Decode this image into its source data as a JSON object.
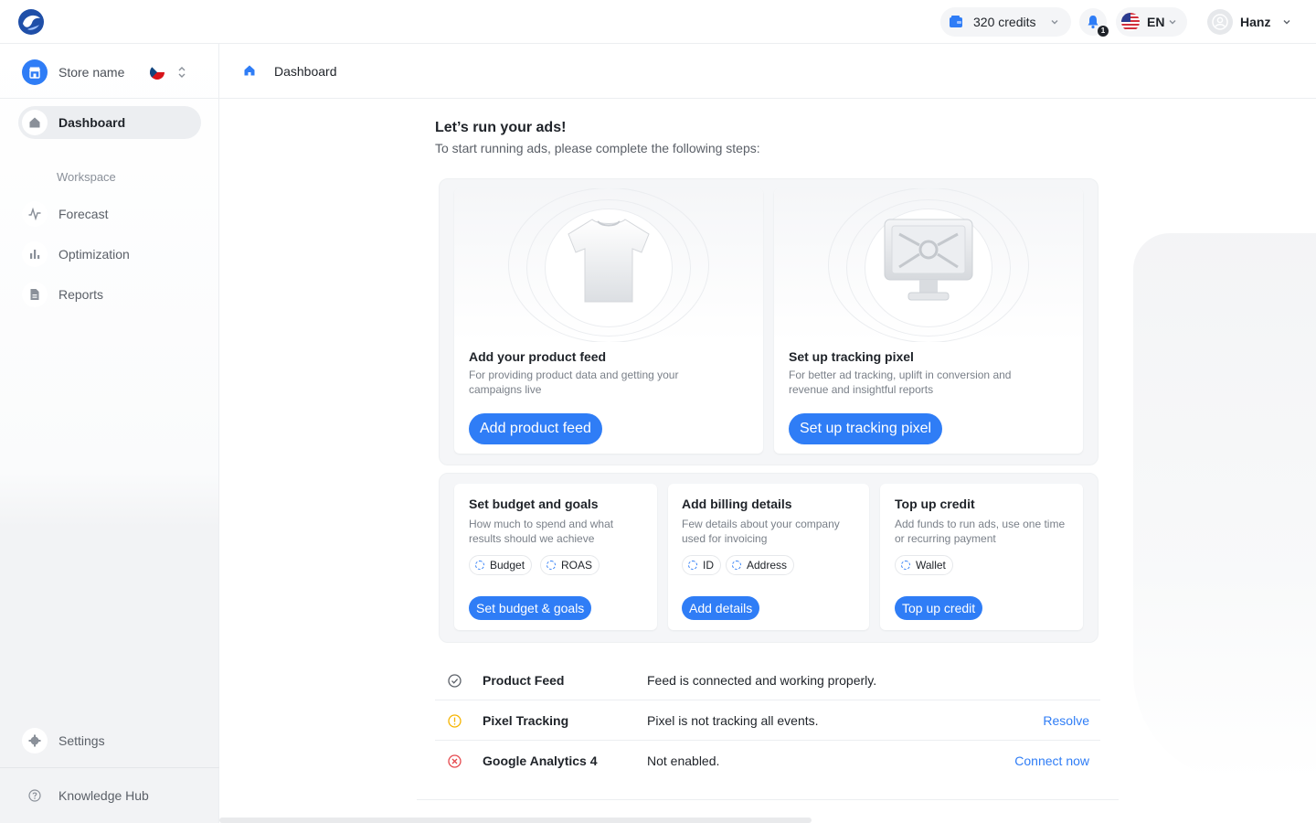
{
  "topbar": {
    "credits_label": "320 credits",
    "notifications_count": "1",
    "language": "EN",
    "user_name": "Hanz"
  },
  "sidebar": {
    "store_name": "Store name",
    "items": [
      {
        "label": "Dashboard",
        "icon": "home-icon",
        "active": true
      },
      {
        "label": "Forecast",
        "icon": "pulse-icon"
      },
      {
        "label": "Optimization",
        "icon": "bar-chart-icon"
      },
      {
        "label": "Reports",
        "icon": "document-icon"
      }
    ],
    "workspace_label": "Workspace",
    "settings_label": "Settings",
    "knowledge_label": "Knowledge Hub"
  },
  "breadcrumb": {
    "current": "Dashboard"
  },
  "main": {
    "title": "Let’s run your ads!",
    "subtitle": "To start running ads, please complete the following steps:",
    "big_cards": [
      {
        "title": "Add your product feed",
        "desc": "For providing product data and getting your campaigns live",
        "button": "Add product feed"
      },
      {
        "title": "Set up tracking pixel",
        "desc": "For better ad tracking, uplift in conversion and revenue and insightful reports",
        "button": "Set up tracking pixel"
      }
    ],
    "small_cards": [
      {
        "title": "Set budget and goals",
        "desc": "How much to spend and what results should we achieve",
        "chips": [
          "Budget",
          "ROAS"
        ],
        "button": "Set budget & goals"
      },
      {
        "title": "Add billing details",
        "desc": "Few details about your company used for invoicing",
        "chips": [
          "ID",
          "Address"
        ],
        "button": "Add details"
      },
      {
        "title": "Top up credit",
        "desc": "Add funds to run ads, use one time or recurring payment",
        "chips": [
          "Wallet"
        ],
        "button": "Top up credit"
      }
    ]
  },
  "status": [
    {
      "name": "Product Feed",
      "message": "Feed is connected and working properly.",
      "action": "",
      "state": "ok"
    },
    {
      "name": "Pixel Tracking",
      "message": "Pixel is not tracking all events.",
      "action": "Resolve",
      "state": "warning"
    },
    {
      "name": "Google Analytics 4",
      "message": "Not enabled.",
      "action": "Connect now",
      "state": "error"
    }
  ],
  "colors": {
    "accent": "#2f7df6",
    "warning": "#f5b400",
    "error": "#e5484d",
    "ok": "#5b6068"
  }
}
